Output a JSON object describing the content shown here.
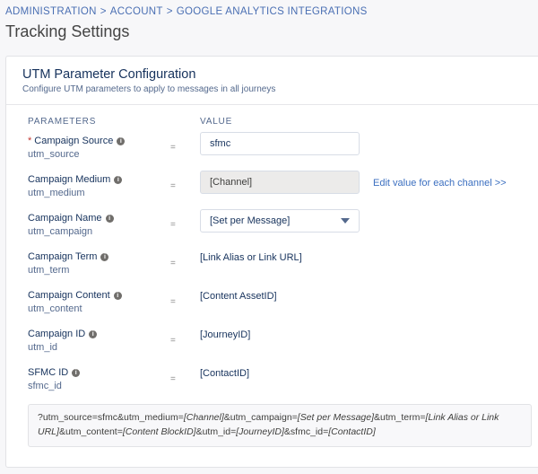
{
  "breadcrumb": [
    "Administration",
    "Account",
    "Google Analytics Integrations"
  ],
  "breadcrumb_separator": ">",
  "page_title": "Tracking Settings",
  "card": {
    "title": "UTM Parameter Configuration",
    "subtitle": "Configure UTM parameters to apply to messages in all journeys",
    "col_parameters": "PARAMETERS",
    "col_value": "VALUE"
  },
  "params": [
    {
      "name": "Campaign Source",
      "key": "utm_source",
      "required": true,
      "value": "sfmc",
      "type": "text-input"
    },
    {
      "name": "Campaign Medium",
      "key": "utm_medium",
      "required": false,
      "value": "[Channel]",
      "type": "disabled-input",
      "link": "Edit value for each channel >>"
    },
    {
      "name": "Campaign Name",
      "key": "utm_campaign",
      "required": false,
      "value": "[Set per Message]",
      "type": "select"
    },
    {
      "name": "Campaign Term",
      "key": "utm_term",
      "required": false,
      "value": "[Link Alias or Link URL]",
      "type": "static"
    },
    {
      "name": "Campaign Content",
      "key": "utm_content",
      "required": false,
      "value": "[Content AssetID]",
      "type": "static"
    },
    {
      "name": "Campaign ID",
      "key": "utm_id",
      "required": false,
      "value": "[JourneyID]",
      "type": "static"
    },
    {
      "name": "SFMC ID",
      "key": "sfmc_id",
      "required": false,
      "value": "[ContactID]",
      "type": "static"
    }
  ],
  "equals": "=",
  "required_mark": "*",
  "info_icon_glyph": "i",
  "preview": [
    {
      "text": "?utm_source=sfmc&utm_medium=",
      "italic": false
    },
    {
      "text": "[Channel]",
      "italic": true
    },
    {
      "text": "&utm_campaign=",
      "italic": false
    },
    {
      "text": "[Set per Message]",
      "italic": true
    },
    {
      "text": "&utm_term=",
      "italic": false
    },
    {
      "text": "[Link Alias or Link URL]",
      "italic": true
    },
    {
      "text": "&utm_content=",
      "italic": false
    },
    {
      "text": "[Content BlockID]",
      "italic": true
    },
    {
      "text": "&utm_id=",
      "italic": false
    },
    {
      "text": "[JourneyID]",
      "italic": true
    },
    {
      "text": "&sfmc_id=",
      "italic": false
    },
    {
      "text": "[ContactID]",
      "italic": true
    }
  ]
}
